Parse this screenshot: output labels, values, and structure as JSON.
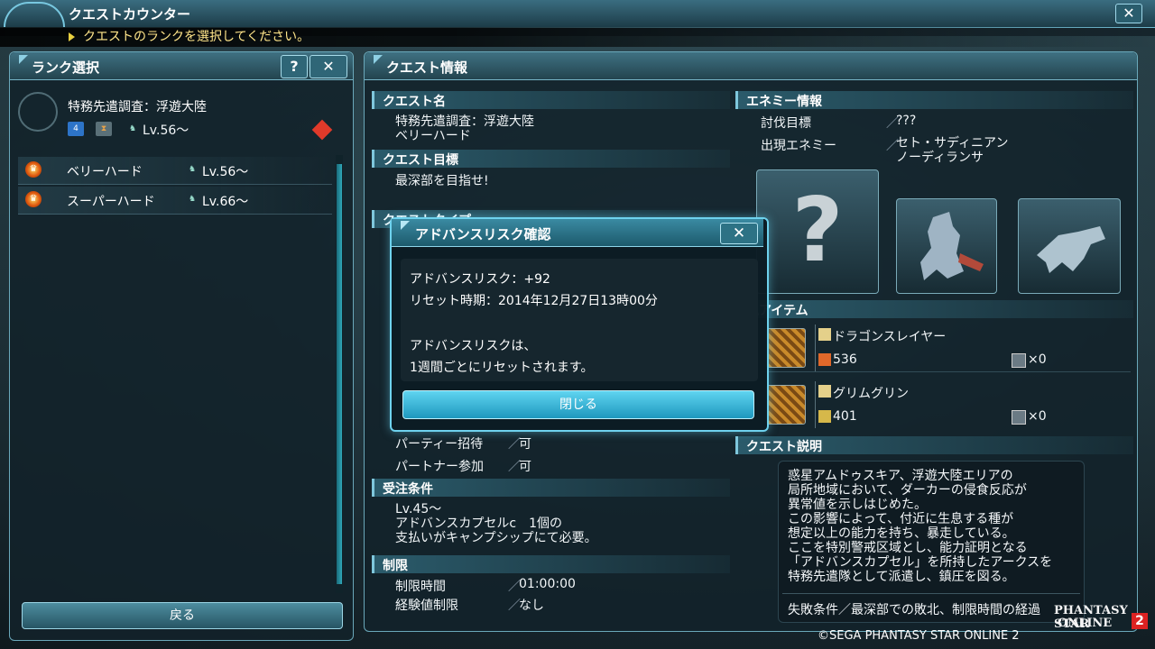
{
  "window": {
    "title": "クエストカウンター",
    "close_label": "✕"
  },
  "instruction": "クエストのランクを選択してください。",
  "rank_panel": {
    "title": "ランク選択",
    "help_label": "?",
    "close_label": "✕",
    "quest": {
      "name": "特務先遣調査：浮遊大陸",
      "party_count": "4",
      "level": "Lv.56～"
    },
    "ranks": [
      {
        "label": "ベリーハード",
        "level": "Lv.56～"
      },
      {
        "label": "スーパーハード",
        "level": "Lv.66～"
      }
    ],
    "back_label": "戻る"
  },
  "quest_info": {
    "title": "クエスト情報",
    "name_header": "クエスト名",
    "name_value": "特務先遣調査：浮遊大陸\nベリーハード",
    "goal_header": "クエスト目標",
    "goal_value": "最深部を目指せ!",
    "type_header": "クエストタイプ",
    "party_invite_label": "パーティー招待",
    "party_invite_value": "可",
    "partner_label": "パートナー参加",
    "partner_value": "可",
    "conditions_header": "受注条件",
    "conditions_value": "Lv.45～\nアドバンスカプセルc　1個の\n支払いがキャンプシップにて必要。",
    "limits_header": "制限",
    "time_limit_label": "制限時間",
    "time_limit_value": "01:00:00",
    "exp_limit_label": "経験値制限",
    "exp_limit_value": "なし",
    "separator": "／"
  },
  "enemy_info": {
    "header": "エネミー情報",
    "target_label": "討伐目標",
    "target_value": "???",
    "appear_label": "出現エネミー",
    "appear_value": "セト・サディニアン\nノーディランサ",
    "unknown_mark": "?"
  },
  "items": {
    "header": "現アイテム",
    "list": [
      {
        "name": "ドラゴンスレイヤー",
        "count": "536",
        "qty": "×0"
      },
      {
        "name": "グリムグリン",
        "count": "401",
        "qty": "×0"
      }
    ]
  },
  "description": {
    "header": "クエスト説明",
    "body": "惑星アムドゥスキア、浮遊大陸エリアの\n局所地域において、ダーカーの侵食反応が\n異常値を示しはじめた。\nこの影響によって、付近に生息する種が\n想定以上の能力を持ち、暴走している。\nここを特別警戒区域とし、能力証明となる\n「アドバンスカプセル」を所持したアークスを\n特務先遣隊として派遣し、鎮圧を図る。",
    "fail": "失敗条件／最深部での敗北、制限時間の経過"
  },
  "modal": {
    "title": "アドバンスリスク確認",
    "close_label": "✕",
    "risk": "アドバンスリスク：+92",
    "reset": "リセット時期：2014年12月27日13時00分",
    "note1": "アドバンスリスクは、",
    "note2": "1週間ごとにリセットされます。",
    "button": "閉じる"
  },
  "copyright": "©SEGA PHANTASY STAR ONLINE 2",
  "logo": {
    "line1": "PHANTASY STAR",
    "line2": "ONLINE",
    "num": "2"
  },
  "colors": {
    "accent": "#6ed2ee",
    "warning": "#ffe58a",
    "panel": "#12222a"
  }
}
